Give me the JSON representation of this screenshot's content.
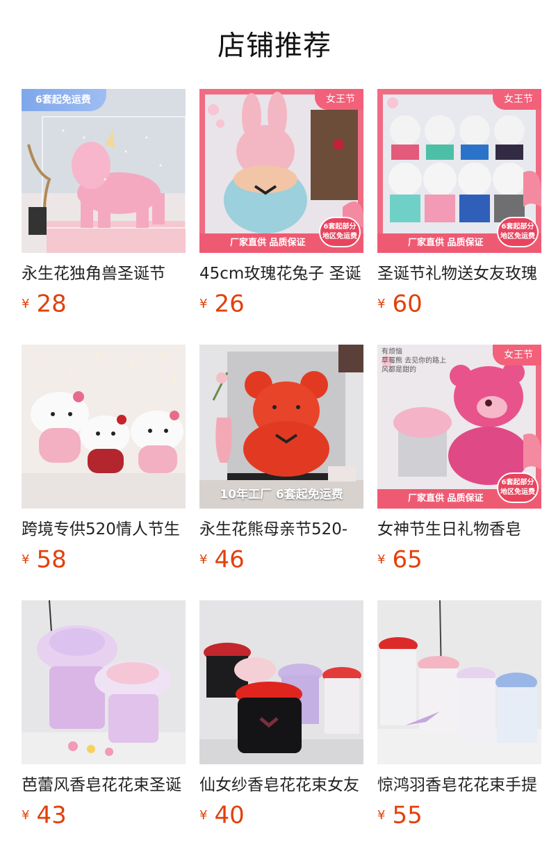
{
  "header": {
    "title": "店铺推荐"
  },
  "products": [
    {
      "name": "永生花独角兽圣诞节",
      "currency": "¥",
      "price": "28",
      "badge": "6套起免运费"
    },
    {
      "name": "45cm玫瑰花兔子 圣诞",
      "currency": "¥",
      "price": "26",
      "badge": "女王节",
      "strip": "厂家直供 品质保证",
      "tag_line1": "6套起部分",
      "tag_line2": "地区免运费"
    },
    {
      "name": "圣诞节礼物送女友玫瑰",
      "currency": "¥",
      "price": "60",
      "badge": "女王节",
      "strip": "厂家直供 品质保证",
      "tag_line1": "6套起部分",
      "tag_line2": "地区免运费"
    },
    {
      "name": "跨境专供520情人节生",
      "currency": "¥",
      "price": "58"
    },
    {
      "name": "永生花熊母亲节520-",
      "currency": "¥",
      "price": "46",
      "caption": "10年工厂 6套起免运费"
    },
    {
      "name": "女神节生日礼物香皂",
      "currency": "¥",
      "price": "65",
      "badge": "女王节",
      "strip": "厂家直供 品质保证",
      "tag_line1": "6套起部分",
      "tag_line2": "地区免运费",
      "poster_line1": "有烦恼",
      "poster_line2": "草莓熊 去见你的路上",
      "poster_line3": "风都是甜的"
    },
    {
      "name": "芭蕾风香皂花花束圣诞",
      "currency": "¥",
      "price": "43"
    },
    {
      "name": "仙女纱香皂花花束女友",
      "currency": "¥",
      "price": "40"
    },
    {
      "name": "惊鸿羽香皂花花束手提",
      "currency": "¥",
      "price": "55"
    }
  ],
  "colors": {
    "price": "#e2400b",
    "festival_badge": "#f2607a",
    "free_badge": "#7ea7ea"
  }
}
